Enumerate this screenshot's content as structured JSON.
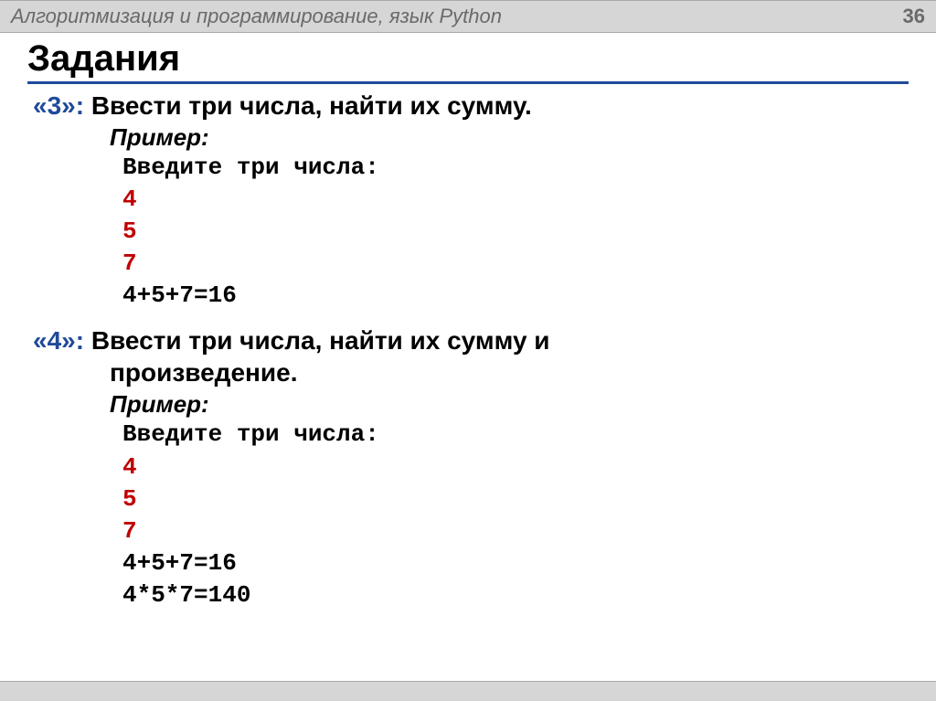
{
  "header": {
    "title": "Алгоритмизация и программирование, язык Python",
    "page_number": "36"
  },
  "page_title": "Задания",
  "tasks": [
    {
      "marker": "«3»:",
      "desc": "Ввести три числа, найти их сумму.",
      "example_label": "Пример:",
      "prompt": "Введите три числа:",
      "inputs": [
        "4",
        "5",
        "7"
      ],
      "outputs": [
        "4+5+7=16"
      ]
    },
    {
      "marker": "«4»:",
      "desc_line1": "Ввести три числа, найти их сумму и",
      "desc_line2": "произведение.",
      "example_label": "Пример:",
      "prompt": "Введите три числа:",
      "inputs": [
        "4",
        "5",
        "7"
      ],
      "outputs": [
        "4+5+7=16",
        "4*5*7=140"
      ]
    }
  ]
}
